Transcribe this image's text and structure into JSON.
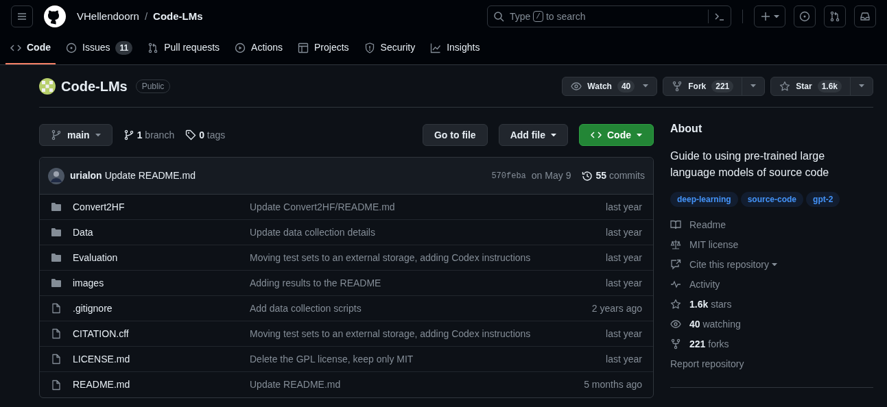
{
  "header": {
    "owner": "VHellendoorn",
    "separator": "/",
    "repo": "Code-LMs",
    "search": {
      "before": "Type",
      "key": "/",
      "after": "to search"
    }
  },
  "tabs": [
    {
      "label": "Code",
      "selected": true
    },
    {
      "label": "Issues",
      "count": "11",
      "selected": false
    },
    {
      "label": "Pull requests",
      "selected": false
    },
    {
      "label": "Actions",
      "selected": false
    },
    {
      "label": "Projects",
      "selected": false
    },
    {
      "label": "Security",
      "selected": false
    },
    {
      "label": "Insights",
      "selected": false
    }
  ],
  "repo": {
    "name": "Code-LMs",
    "visibility": "Public"
  },
  "repo_actions": [
    {
      "label": "Watch",
      "count": "40",
      "split": false
    },
    {
      "label": "Fork",
      "count": "221",
      "split": true
    },
    {
      "label": "Star",
      "count": "1.6k",
      "split": true
    }
  ],
  "branch": {
    "name": "main",
    "branches": "**1** branch",
    "tags": "**0** tags"
  },
  "buttons": [
    {
      "label": "Go to file",
      "kind": "plain"
    },
    {
      "label": "Add file",
      "kind": "menu"
    },
    {
      "label": "Code",
      "kind": "primary"
    }
  ],
  "commit": {
    "author": "urialon",
    "message": "Update README.md",
    "hash": "570feba",
    "date": "on May 9",
    "commits": "**55** commits"
  },
  "files": [
    {
      "kind": "dir",
      "name": "Convert2HF",
      "message": "Update Convert2HF/README.md",
      "time": "last year"
    },
    {
      "kind": "dir",
      "name": "Data",
      "message": "Update data collection details",
      "time": "last year"
    },
    {
      "kind": "dir",
      "name": "Evaluation",
      "message": "Moving test sets to an external storage, adding Codex instructions",
      "time": "last year"
    },
    {
      "kind": "dir",
      "name": "images",
      "message": "Adding results to the README",
      "time": "last year"
    },
    {
      "kind": "file",
      "name": ".gitignore",
      "message": "Add data collection scripts",
      "time": "2 years ago"
    },
    {
      "kind": "file",
      "name": "CITATION.cff",
      "message": "Moving test sets to an external storage, adding Codex instructions",
      "time": "last year"
    },
    {
      "kind": "file",
      "name": "LICENSE.md",
      "message": "Delete the GPL license, keep only MIT",
      "time": "last year"
    },
    {
      "kind": "file",
      "name": "README.md",
      "message": "Update README.md",
      "time": "5 months ago"
    }
  ],
  "about": {
    "title": "About",
    "description": "Guide to using pre-trained large language models of source code",
    "topics": [
      "deep-learning",
      "source-code",
      "gpt-2"
    ],
    "links": [
      {
        "text": "Readme",
        "menu": false
      },
      {
        "text": "MIT license",
        "menu": false
      },
      {
        "text": "Cite this repository",
        "menu": true
      },
      {
        "text": "Activity",
        "menu": false
      },
      {
        "text": "**1.6k** stars",
        "menu": false
      },
      {
        "text": "**40** watching",
        "menu": false
      },
      {
        "text": "**221** forks",
        "menu": false
      },
      {
        "text": "Report repository",
        "menu": false
      }
    ]
  }
}
